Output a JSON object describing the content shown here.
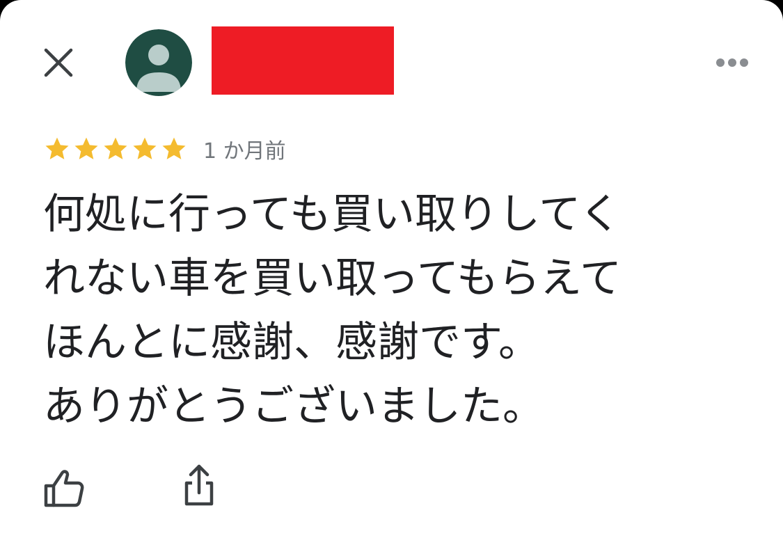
{
  "header": {
    "close_icon": "close-icon",
    "avatar_icon": "default-avatar-icon",
    "more_icon": "more-horizontal-icon",
    "colors": {
      "avatar_bg": "#1f4d43",
      "avatar_fg": "#b9cdca",
      "redaction": "#ee1c25"
    }
  },
  "review": {
    "rating": 5,
    "rating_max": 5,
    "star_color": "#f4bb2f",
    "time": "1 か月前",
    "text": "何処に行っても買い取りしてく\nれない車を買い取ってもらえて\nほんとに感謝、感謝です。\nありがとうございました。"
  },
  "actions": {
    "like_icon": "thumbs-up-icon",
    "share_icon": "share-icon"
  }
}
